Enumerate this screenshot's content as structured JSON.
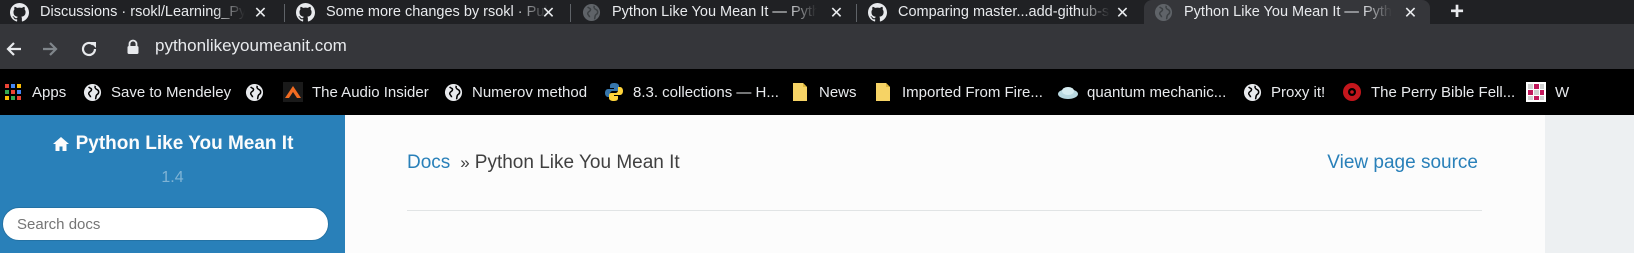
{
  "tabs": [
    {
      "title": "Discussions · rsokl/Learning_Python",
      "icon": "github-icon",
      "active": false
    },
    {
      "title": "Some more changes by rsokl · Pull",
      "icon": "github-icon",
      "active": false
    },
    {
      "title": "Python Like You Mean It — Python",
      "icon": "globe-icon",
      "active": false
    },
    {
      "title": "Comparing master...add-github-s",
      "icon": "github-icon",
      "active": false
    },
    {
      "title": "Python Like You Mean It — Python",
      "icon": "globe-icon",
      "active": true
    }
  ],
  "toolbar": {
    "url": "pythonlikeyoumeanit.com"
  },
  "bookmarks": [
    {
      "label": "Apps",
      "icon": "apps-grid-icon"
    },
    {
      "label": "Save to Mendeley",
      "icon": "globe-icon"
    },
    {
      "label": "",
      "icon": "globe-icon"
    },
    {
      "label": "The Audio Insider",
      "icon": "audio-insider-icon"
    },
    {
      "label": "Numerov method",
      "icon": "globe-icon"
    },
    {
      "label": "8.3. collections — H...",
      "icon": "python-icon"
    },
    {
      "label": "News",
      "icon": "folder-icon"
    },
    {
      "label": "Imported From Fire...",
      "icon": "folder-icon"
    },
    {
      "label": "quantum mechanic...",
      "icon": "cloud-icon"
    },
    {
      "label": "Proxy it!",
      "icon": "globe-icon"
    },
    {
      "label": "The Perry Bible Fell...",
      "icon": "perry-bible-icon"
    },
    {
      "label": "W",
      "icon": "grid-icon"
    }
  ],
  "sidebar": {
    "project_title": "Python Like You Mean It",
    "version": "1.4",
    "search_placeholder": "Search docs"
  },
  "main": {
    "breadcrumb_root": "Docs",
    "breadcrumb_separator": "»",
    "breadcrumb_current": "Python Like You Mean It",
    "view_source": "View page source"
  },
  "colors": {
    "sidebar_bg": "#2980b9",
    "link": "#2980b9",
    "chrome_dark": "#202124",
    "chrome_toolbar": "#35363a"
  }
}
